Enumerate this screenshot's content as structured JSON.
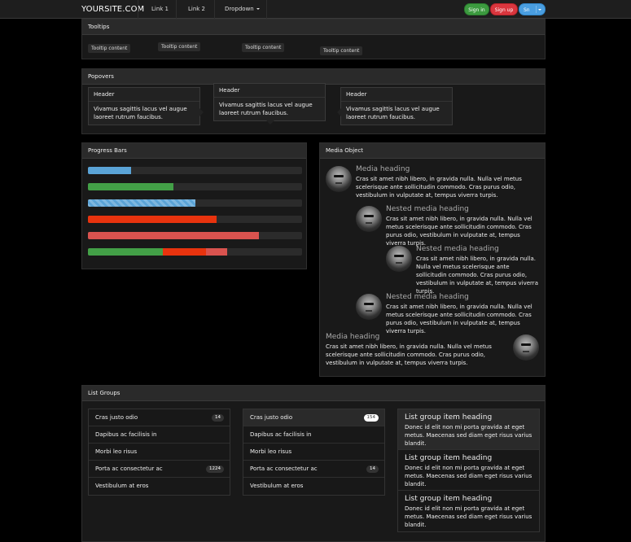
{
  "navbar": {
    "brand": "YOURSITE.COM",
    "links": [
      "Link 1",
      "Link 2"
    ],
    "dropdown": "Dropdown",
    "buttons": {
      "signin": "Sign in",
      "signup": "Sign up",
      "split": "Sn"
    }
  },
  "tooltips": {
    "title": "Tooltips",
    "items": [
      "Tooltip content",
      "Tooltip content",
      "Tooltip content",
      "Tooltip content"
    ]
  },
  "popovers": {
    "title": "Popovers",
    "items": [
      {
        "header": "Header",
        "body": "Vivamus sagittis lacus vel augue laoreet rutrum faucibus."
      },
      {
        "header": "Header",
        "body": "Vivamus sagittis lacus vel augue laoreet rutrum faucibus."
      },
      {
        "header": "Header",
        "body": "Vivamus sagittis lacus vel augue laoreet rutrum faucibus."
      }
    ]
  },
  "progress": {
    "title": "Progress Bars",
    "bars": [
      {
        "segments": [
          {
            "value": 20,
            "color": "#5aa3d6"
          }
        ]
      },
      {
        "segments": [
          {
            "value": 40,
            "color": "#43a047"
          }
        ]
      },
      {
        "segments": [
          {
            "value": 50,
            "color": "#5aa3d6",
            "striped": true
          }
        ]
      },
      {
        "segments": [
          {
            "value": 60,
            "color": "#e8330e"
          }
        ]
      },
      {
        "segments": [
          {
            "value": 80,
            "color": "#d9534f"
          }
        ]
      },
      {
        "segments": [
          {
            "value": 35,
            "color": "#43a047"
          },
          {
            "value": 20,
            "color": "#e8330e"
          },
          {
            "value": 10,
            "color": "#d9534f"
          }
        ]
      }
    ]
  },
  "media": {
    "title": "Media Object",
    "items": [
      {
        "heading": "Media heading",
        "body": "Cras sit amet nibh libero, in gravida nulla. Nulla vel metus scelerisque ante sollicitudin commodo. Cras purus odio, vestibulum in vulputate at, tempus viverra turpis."
      },
      {
        "heading": "Nested media heading",
        "body": "Cras sit amet nibh libero, in gravida nulla. Nulla vel metus scelerisque ante sollicitudin commodo. Cras purus odio, vestibulum in vulputate at, tempus viverra turpis."
      },
      {
        "heading": "Nested media heading",
        "body": "Cras sit amet nibh libero, in gravida nulla. Nulla vel metus scelerisque ante sollicitudin commodo. Cras purus odio, vestibulum in vulputate at, tempus viverra turpis."
      },
      {
        "heading": "Nested media heading",
        "body": "Cras sit amet nibh libero, in gravida nulla. Nulla vel metus scelerisque ante sollicitudin commodo. Cras purus odio, vestibulum in vulputate at, tempus viverra turpis."
      },
      {
        "heading": "Media heading",
        "body": "Cras sit amet nibh libero, in gravida nulla. Nulla vel metus scelerisque ante sollicitudin commodo. Cras purus odio, vestibulum in vulputate at, tempus viverra turpis."
      }
    ]
  },
  "listgroups": {
    "title": "List Groups",
    "group1": [
      {
        "label": "Cras justo odio",
        "badge": "14"
      },
      {
        "label": "Dapibus ac facilisis in",
        "badge": ""
      },
      {
        "label": "Morbi leo risus",
        "badge": ""
      },
      {
        "label": "Porta ac consectetur ac",
        "badge": "1224"
      },
      {
        "label": "Vestibulum at eros",
        "badge": ""
      }
    ],
    "group2": [
      {
        "label": "Cras justo odio",
        "badge": "154"
      },
      {
        "label": "Dapibus ac facilisis in",
        "badge": ""
      },
      {
        "label": "Morbi leo risus",
        "badge": ""
      },
      {
        "label": "Porta ac consectetur ac",
        "badge": "14"
      },
      {
        "label": "Vestibulum at eros",
        "badge": ""
      }
    ],
    "group3": [
      {
        "heading": "List group item heading",
        "text": "Donec id elit non mi porta gravida at eget metus. Maecenas sed diam eget risus varius blandit."
      },
      {
        "heading": "List group item heading",
        "text": "Donec id elit non mi porta gravida at eget metus. Maecenas sed diam eget risus varius blandit."
      },
      {
        "heading": "List group item heading",
        "text": "Donec id elit non mi porta gravida at eget metus. Maecenas sed diam eget risus varius blandit."
      }
    ]
  }
}
